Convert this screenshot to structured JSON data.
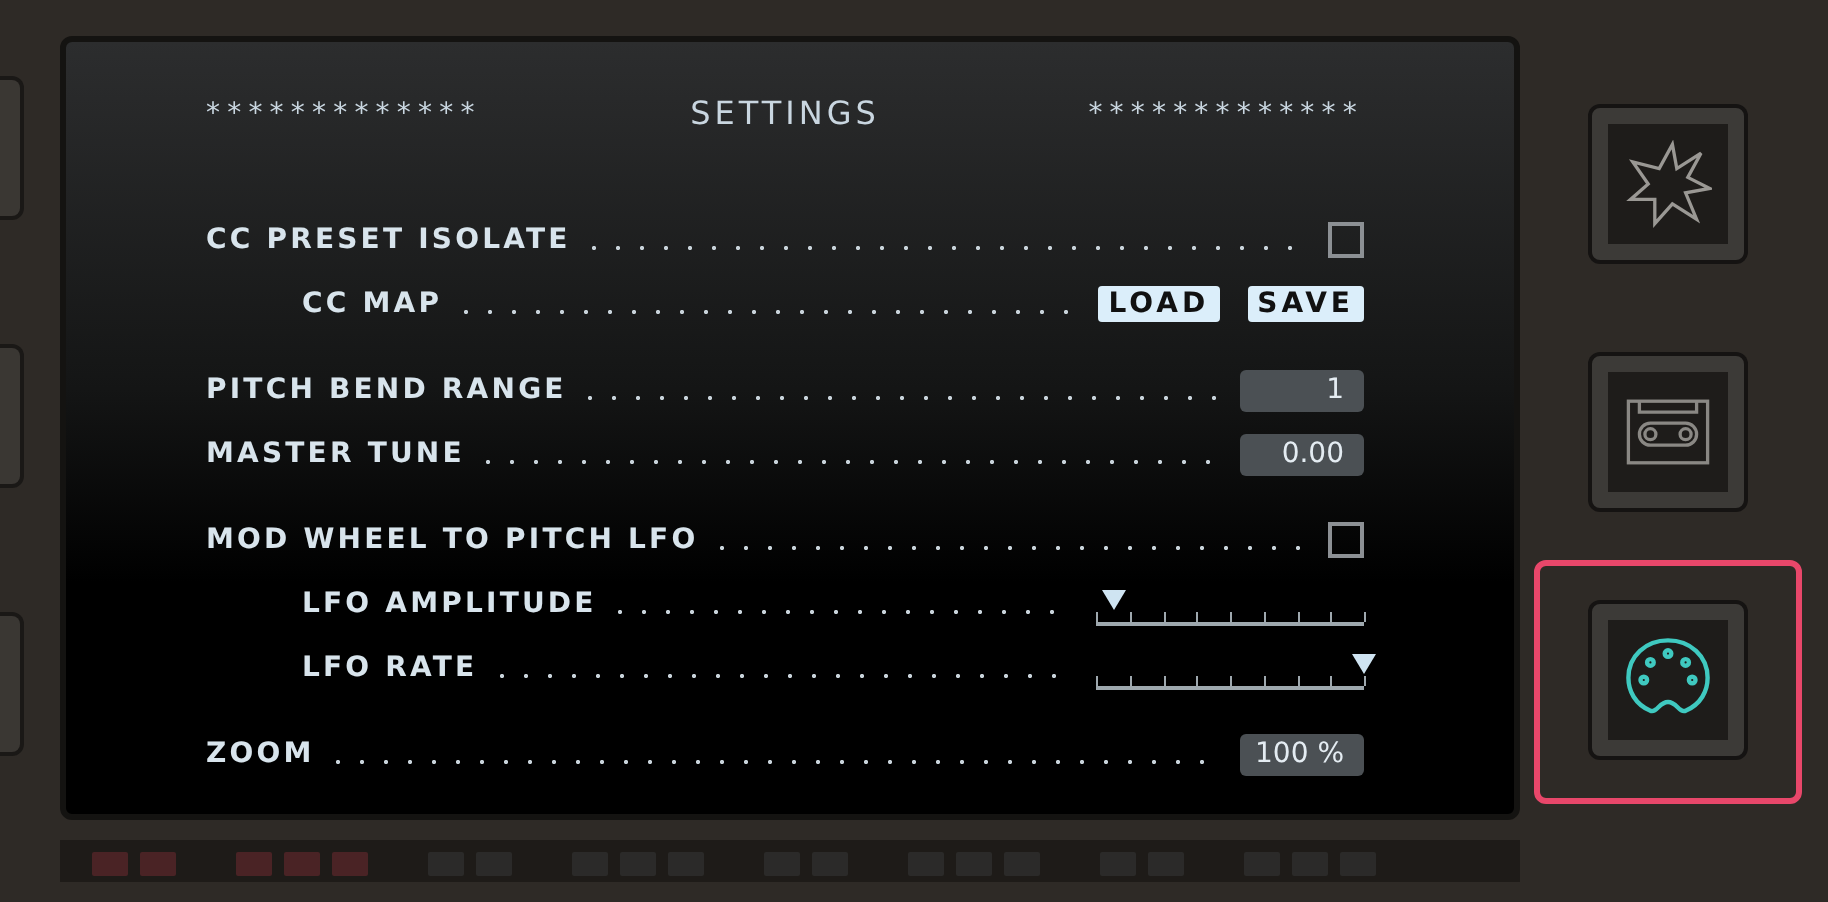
{
  "header": {
    "stars_left": "*************",
    "title": "SETTINGS",
    "stars_right": "*************"
  },
  "groups": [
    {
      "rows": [
        {
          "label": "CC PRESET ISOLATE",
          "control": {
            "kind": "checkbox",
            "checked": false
          },
          "children": [
            {
              "label": "CC MAP",
              "control": {
                "kind": "buttons",
                "buttons": [
                  "LOAD",
                  "SAVE"
                ]
              }
            }
          ]
        }
      ]
    },
    {
      "rows": [
        {
          "label": "PITCH BEND RANGE",
          "control": {
            "kind": "value",
            "value": "1"
          }
        },
        {
          "label": "MASTER TUNE",
          "control": {
            "kind": "value",
            "value": "0.00"
          }
        }
      ]
    },
    {
      "rows": [
        {
          "label": "MOD WHEEL TO PITCH LFO",
          "control": {
            "kind": "checkbox",
            "checked": false
          },
          "children": [
            {
              "label": "LFO AMPLITUDE",
              "control": {
                "kind": "slider",
                "level": 0.07
              }
            },
            {
              "label": "LFO RATE",
              "control": {
                "kind": "slider",
                "level": 1
              }
            }
          ]
        }
      ]
    },
    {
      "rows": [
        {
          "label": "ZOOM",
          "control": {
            "kind": "value",
            "value": "100 %"
          }
        }
      ]
    }
  ],
  "side_buttons": [
    {
      "kind": "star",
      "selected": false
    },
    {
      "kind": "cassette",
      "selected": false
    },
    {
      "kind": "midi",
      "selected": true
    }
  ]
}
